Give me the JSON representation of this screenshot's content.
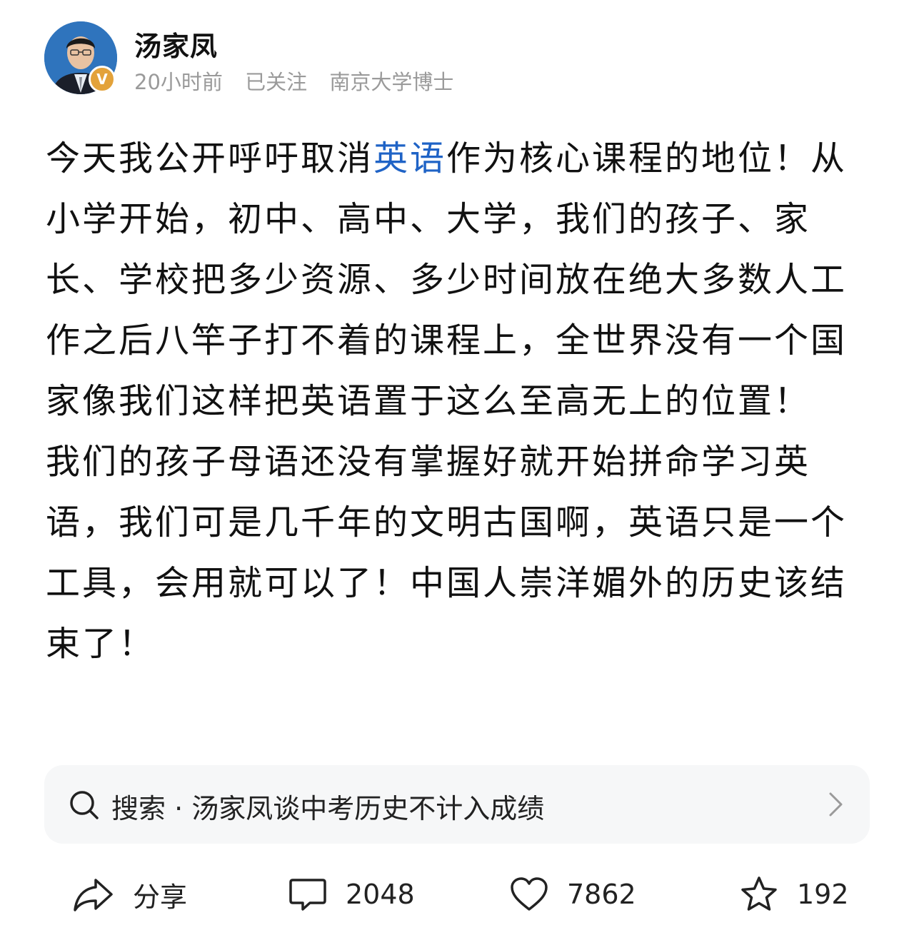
{
  "author": {
    "name": "汤家凤",
    "verified_badge": "V",
    "time": "20小时前",
    "follow_status": "已关注",
    "description": "南京大学博士"
  },
  "post": {
    "p1_before": "今天我公开呼吁取消",
    "p1_link": "英语",
    "p1_after": "作为核心课程的地位！从小学开始，初中、高中、大学，我们的孩子、家长、学校把多少资源、多少时间放在绝大多数人工作之后八竿子打不着的课程上，全世界没有一个国家像我们这样把英语置于这么至高无上的位置！",
    "p2": "我们的孩子母语还没有掌握好就开始拼命学习英语，我们可是几千年的文明古国啊，英语只是一个工具，会用就可以了！中国人崇洋媚外的历史该结束了！",
    "link_color": "#1f63c6"
  },
  "search_card": {
    "label": "搜索 · 汤家凤谈中考历史不计入成绩"
  },
  "actions": {
    "share": "分享",
    "comments": "2048",
    "likes": "7862",
    "favorites": "192"
  }
}
